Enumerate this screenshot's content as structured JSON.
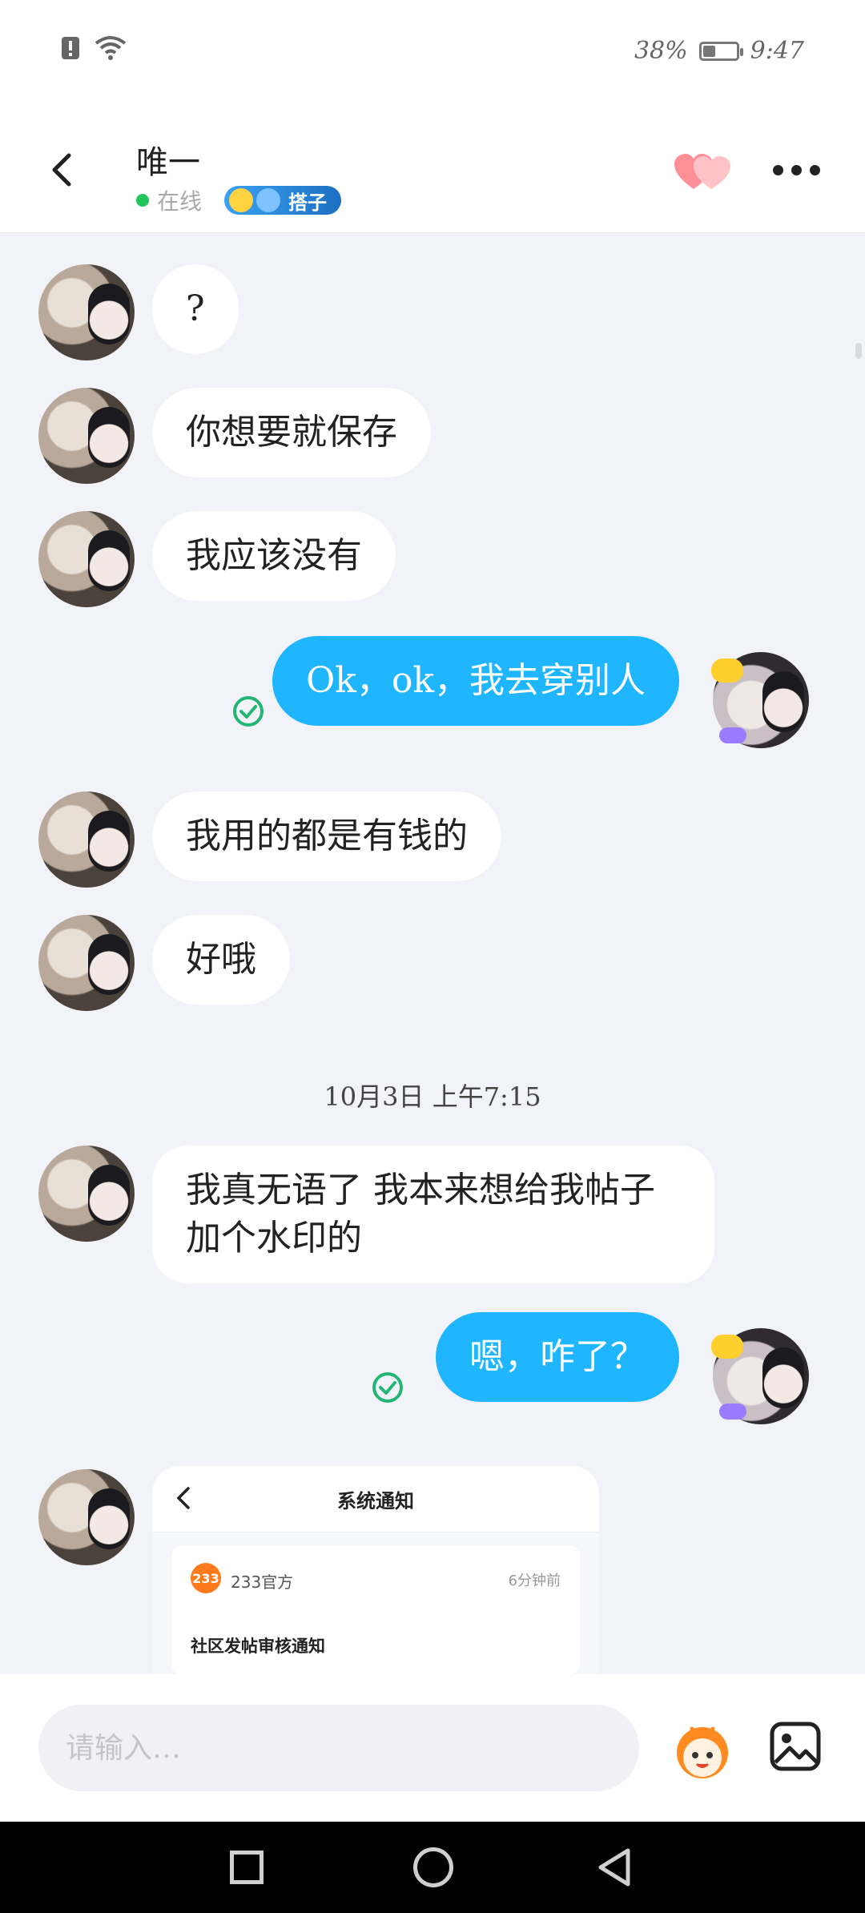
{
  "status_bar": {
    "battery_text": "38%",
    "time": "9:47",
    "battery_level": 0.38
  },
  "header": {
    "title": "唯一",
    "status": "在线",
    "badge_label": "搭子"
  },
  "messages": [
    {
      "side": "in",
      "text": "?"
    },
    {
      "side": "in",
      "text": "你想要就保存"
    },
    {
      "side": "in",
      "text": "我应该没有"
    },
    {
      "side": "out",
      "text": "Ok，ok，我去穿别人"
    },
    {
      "side": "in",
      "text": "我用的都是有钱的"
    },
    {
      "side": "in",
      "text": "好哦"
    },
    {
      "side": "in",
      "text": "我真无语了 我本来想给我帖子加个水印的"
    },
    {
      "side": "out",
      "text": "嗯，咋了？"
    }
  ],
  "timestamp": "10月3日 上午7:15",
  "shared_card": {
    "title": "系统通知",
    "logo": "233",
    "source": "233官方",
    "time": "6分钟前",
    "notice_title": "社区发帖审核通知"
  },
  "input": {
    "placeholder": "请输入…"
  },
  "icons": {
    "back": "back-arrow-icon",
    "hearts": "hearts-icon",
    "more": "more-icon",
    "emoji": "mascot-emoji-icon",
    "image": "image-icon"
  },
  "colors": {
    "out_bubble": "#1fb6ff",
    "in_bubble": "#ffffff",
    "online": "#22c55e",
    "background": "#f2f3f8"
  }
}
